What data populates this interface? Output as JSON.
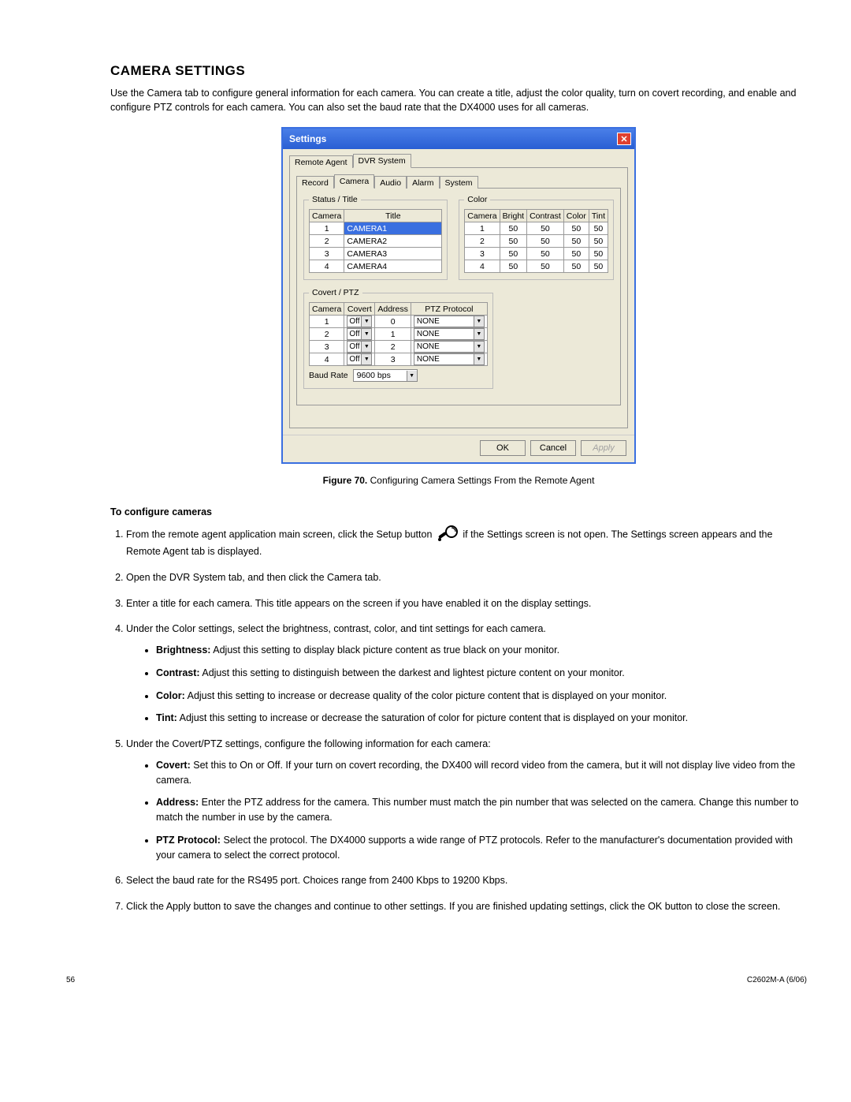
{
  "heading": "CAMERA SETTINGS",
  "intro": "Use the Camera tab to configure general information for each camera. You can create a title, adjust the color quality, turn on covert recording, and enable and configure PTZ controls for each camera. You can also set the baud rate that the DX4000 uses for all cameras.",
  "dialog": {
    "title": "Settings",
    "outer_tabs": [
      "Remote Agent",
      "DVR System"
    ],
    "inner_tabs": [
      "Record",
      "Camera",
      "Audio",
      "Alarm",
      "System"
    ],
    "status_title_legend": "Status / Title",
    "status_headers": {
      "cam": "Camera",
      "title": "Title"
    },
    "status_rows": [
      {
        "cam": "1",
        "title": "CAMERA1",
        "hl": true
      },
      {
        "cam": "2",
        "title": "CAMERA2",
        "hl": false
      },
      {
        "cam": "3",
        "title": "CAMERA3",
        "hl": false
      },
      {
        "cam": "4",
        "title": "CAMERA4",
        "hl": false
      }
    ],
    "color_legend": "Color",
    "color_headers": {
      "cam": "Camera",
      "bright": "Bright",
      "contrast": "Contrast",
      "color": "Color",
      "tint": "Tint"
    },
    "color_rows": [
      {
        "cam": "1",
        "bright": "50",
        "contrast": "50",
        "color": "50",
        "tint": "50"
      },
      {
        "cam": "2",
        "bright": "50",
        "contrast": "50",
        "color": "50",
        "tint": "50"
      },
      {
        "cam": "3",
        "bright": "50",
        "contrast": "50",
        "color": "50",
        "tint": "50"
      },
      {
        "cam": "4",
        "bright": "50",
        "contrast": "50",
        "color": "50",
        "tint": "50"
      }
    ],
    "covert_legend": "Covert / PTZ",
    "covert_headers": {
      "cam": "Camera",
      "covert": "Covert",
      "addr": "Address",
      "proto": "PTZ Protocol"
    },
    "covert_rows": [
      {
        "cam": "1",
        "covert": "Off",
        "addr": "0",
        "proto": "NONE"
      },
      {
        "cam": "2",
        "covert": "Off",
        "addr": "1",
        "proto": "NONE"
      },
      {
        "cam": "3",
        "covert": "Off",
        "addr": "2",
        "proto": "NONE"
      },
      {
        "cam": "4",
        "covert": "Off",
        "addr": "3",
        "proto": "NONE"
      }
    ],
    "baud_label": "Baud Rate",
    "baud_value": "9600 bps",
    "buttons": {
      "ok": "OK",
      "cancel": "Cancel",
      "apply": "Apply"
    }
  },
  "figure": {
    "label": "Figure 70.",
    "caption": "Configuring Camera Settings From the Remote Agent"
  },
  "subhead": "To configure cameras",
  "steps": {
    "s1a": "From the remote agent application main screen, click the Setup button",
    "s1b": "if the Settings screen is not open. The Settings screen appears and the Remote Agent tab is displayed.",
    "s2": "Open the DVR System tab, and then click the Camera tab.",
    "s3": "Enter a title for each camera. This title appears on the screen if you have enabled it on the display settings.",
    "s4": "Under the Color settings, select the brightness, contrast, color, and tint settings for each camera.",
    "s4b": [
      {
        "term": "Brightness:",
        "text": "Adjust this setting to display black picture content as true black on your monitor."
      },
      {
        "term": "Contrast:",
        "text": "Adjust this setting to distinguish between the darkest and lightest picture content on your monitor."
      },
      {
        "term": "Color:",
        "text": "Adjust this setting to increase or decrease quality of the color picture content that is displayed on your monitor."
      },
      {
        "term": "Tint:",
        "text": "Adjust this setting to increase or decrease the saturation of color for picture content that is displayed on your monitor."
      }
    ],
    "s5": "Under the Covert/PTZ settings, configure the following information for each camera:",
    "s5b": [
      {
        "term": "Covert:",
        "text": "Set this to On or Off. If your turn on covert recording, the DX400 will record video from the camera, but it will not display live video from the camera."
      },
      {
        "term": "Address:",
        "text": "Enter the PTZ address for the camera. This number must match the pin number that was selected on the camera. Change this number to match the number in use by the camera."
      },
      {
        "term": "PTZ Protocol:",
        "text": "Select the protocol. The DX4000 supports a wide range of PTZ protocols. Refer to the manufacturer's documentation provided with your camera to select the correct protocol."
      }
    ],
    "s6": "Select the baud rate for the RS495 port. Choices range from 2400 Kbps to 19200 Kbps.",
    "s7": "Click the Apply button to save the changes and continue to other settings. If you are finished updating settings, click the OK button to close the screen."
  },
  "footer": {
    "page": "56",
    "doc": "C2602M-A (6/06)"
  }
}
